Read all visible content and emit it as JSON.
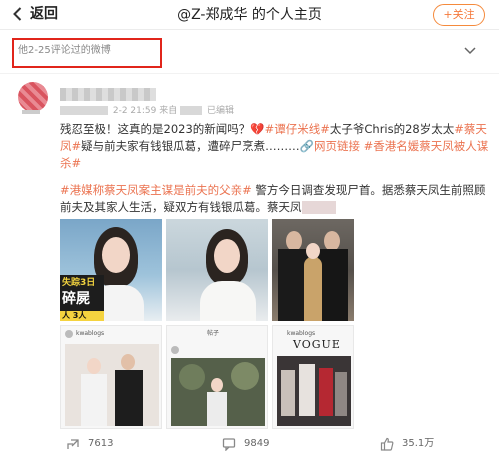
{
  "header": {
    "back_label": "返回",
    "title": "@Z-郑成华 的个人主页",
    "follow_label": "+关注"
  },
  "filter": {
    "label": "他2-25评论过的微博"
  },
  "post": {
    "meta_time": "2-2 21:59",
    "meta_from": "来自",
    "meta_edited": "已编辑",
    "para1": {
      "t1": "残忍至极！这真的是2023的新闻吗？",
      "t2": "💔",
      "t3": "#谭仔米线#",
      "t4": "太子爷Chris的28岁太太",
      "t5": "#蔡天凤#",
      "t6": "疑与前夫家有钱银瓜葛，遭碎尸烹煮………",
      "t7": "🔗网页链接",
      "t8": " ",
      "t9": "#香港名媛蔡天凤被人谋杀#"
    },
    "para2": {
      "t1": "#港媒称蔡天凤案主谋是前夫的父亲#",
      "t2": " 警方今日调查发现尸首。据悉蔡天凤生前照顾前夫及其家人生活，疑双方有钱银瓜葛。蔡天凤"
    },
    "images": {
      "img1_overlay_line1": "失踪3日",
      "img1_overlay_line2": "碎屍",
      "img1_overlay_line3": "人 3人",
      "img4_header": "kwablogs",
      "img5_header": "帖子",
      "img6_header": "kwablogs",
      "img6_vogue": "VOGUE"
    },
    "actions": {
      "share_count": "7613",
      "comment_count": "9849",
      "like_count": "35.1万"
    }
  },
  "colors": {
    "accent": "#eb7350",
    "follow": "#f5793b",
    "highlight_box": "#e1251b"
  }
}
